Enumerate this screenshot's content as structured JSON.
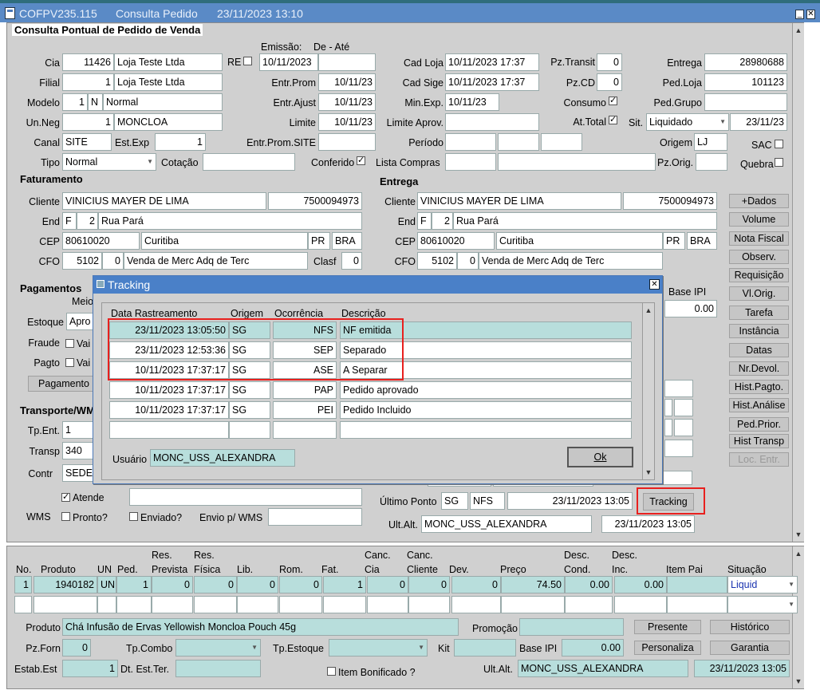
{
  "window": {
    "app_code": "COFPV235.115",
    "screen": "Consulta Pedido",
    "datetime": "23/11/2023 13:10",
    "min_label": "_",
    "close_label": "✕"
  },
  "form": {
    "title": "Consulta Pontual de Pedido de Venda",
    "emissao_label": "Emissão:",
    "de_ate_label": "De - Até",
    "cia_label": "Cia",
    "cia_code": "11426",
    "cia_name": "Loja Teste Ltda",
    "re_label": "RE",
    "emissao_de": "10/11/2023",
    "cad_loja_label": "Cad Loja",
    "cad_loja": "10/11/2023 17:37",
    "pz_transit_label": "Pz.Transit",
    "pz_transit": "0",
    "entrega_label": "Entrega",
    "entrega": "28980688",
    "filial_label": "Filial",
    "filial_code": "1",
    "filial_name": "Loja Teste Ltda",
    "entr_prom_label": "Entr.Prom",
    "entr_prom": "10/11/23",
    "cad_sige_label": "Cad Sige",
    "cad_sige": "10/11/2023 17:37",
    "pz_cd_label": "Pz.CD",
    "pz_cd": "0",
    "ped_loja_label": "Ped.Loja",
    "ped_loja": "101123",
    "modelo_label": "Modelo",
    "modelo_code": "1",
    "modelo_flag": "N",
    "modelo_name": "Normal",
    "entr_ajust_label": "Entr.Ajust",
    "entr_ajust": "10/11/23",
    "min_exp_label": "Min.Exp.",
    "min_exp": "10/11/23",
    "consumo_label": "Consumo",
    "ped_grupo_label": "Ped.Grupo",
    "un_neg_label": "Un.Neg",
    "un_neg_code": "1",
    "un_neg_name": "MONCLOA",
    "limite_label": "Limite",
    "limite": "10/11/23",
    "limite_aprov_label": "Limite Aprov.",
    "at_total_label": "At.Total",
    "sit_label": "Sit.",
    "sit_value": "Liquidado",
    "sit_date": "23/11/23",
    "canal_label": "Canal",
    "canal": "SITE",
    "est_exp_label": "Est.Exp",
    "est_exp": "1",
    "entr_prom_site_label": "Entr.Prom.SITE",
    "periodo_label": "Período",
    "origem_label": "Origem",
    "origem": "LJ",
    "sac_label": "SAC",
    "tipo_label": "Tipo",
    "tipo": "Normal",
    "cotacao_label": "Cotação",
    "conferido_label": "Conferido",
    "lista_compras_label": "Lista Compras",
    "pz_orig_label": "Pz.Orig.",
    "quebra_label": "Quebra",
    "faturamento_label": "Faturamento",
    "entrega_section_label": "Entrega",
    "cliente_label": "Cliente",
    "end_label": "End",
    "cep_label": "CEP",
    "cfo_label": "CFO",
    "clasf_label": "Clasf",
    "fat_cliente": "VINICIUS MAYER DE LIMA",
    "fat_cliente_code": "7500094973",
    "fat_end_type": "F",
    "fat_end_num": "2",
    "fat_end_street": "Rua Pará",
    "fat_cep": "80610020",
    "fat_city": "Curitiba",
    "fat_uf": "PR",
    "fat_country": "BRA",
    "fat_cfo": "5102",
    "fat_cfo_seq": "0",
    "fat_cfo_desc": "Venda de Merc Adq de Terc",
    "clasf": "0",
    "ent_cliente": "VINICIUS MAYER DE LIMA",
    "ent_cliente_code": "7500094973",
    "ent_end_type": "F",
    "ent_end_num": "2",
    "ent_end_street": "Rua Pará",
    "ent_cep": "80610020",
    "ent_city": "Curitiba",
    "ent_uf": "PR",
    "ent_country": "BRA",
    "ent_cfo": "5102",
    "ent_cfo_seq": "0",
    "ent_cfo_desc": "Venda de Merc Adq de Terc",
    "pagamentos_label": "Pagamentos",
    "meio_label": "Meio",
    "estoque_label": "Estoque",
    "estoque_value": "Apro",
    "fraude_label": "Fraude",
    "fraude_chk": "Vai",
    "pagto_label": "Pagto",
    "pagto_chk": "Vai",
    "pagamento_btn": "Pagamento",
    "base_ipi_label": "Base IPI",
    "base_ipi": "0.00",
    "transporte_label": "Transporte/WM",
    "tp_ent_label": "Tp.Ent.",
    "tp_ent": "1",
    "transp_label": "Transp",
    "transp": "340",
    "contr_label": "Contr",
    "contr": "SEDE",
    "atende_label": "Atende",
    "wms_label": "WMS",
    "pronto_label": "Pronto?",
    "enviado_label": "Enviado?",
    "envio_wms_label": "Envio p/ WMS",
    "ultimo_ponto_label": "Último Ponto",
    "ultimo_ponto_origem": "SG",
    "ultimo_ponto_code": "NFS",
    "ultimo_ponto_date": "23/11/2023 13:05",
    "tracking_btn": "Tracking",
    "ult_alt_label": "Ult.Alt.",
    "ult_alt_user": "MONC_USS_ALEXANDRA",
    "ult_alt_date": "23/11/2023 13:05"
  },
  "side_buttons": [
    "+Dados",
    "Volume",
    "Nota Fiscal",
    "Observ.",
    "Requisição",
    "Vl.Orig.",
    "Tarefa",
    "Instância",
    "Datas",
    "Nr.Devol.",
    "Hist.Pagto.",
    "Hist.Análise",
    "Ped.Prior.",
    "Hist Transp",
    "Loc. Entr."
  ],
  "tracking": {
    "title": "Tracking",
    "close_label": "✕",
    "headers": {
      "data": "Data Rastreamento",
      "origem": "Origem",
      "ocorrencia": "Ocorrência",
      "descricao": "Descrição"
    },
    "rows": [
      {
        "data": "23/11/2023 13:05:50",
        "origem": "SG",
        "ocorrencia": "NFS",
        "descricao": "NF emitida"
      },
      {
        "data": "23/11/2023 12:53:36",
        "origem": "SG",
        "ocorrencia": "SEP",
        "descricao": "Separado"
      },
      {
        "data": "10/11/2023 17:37:17",
        "origem": "SG",
        "ocorrencia": "ASE",
        "descricao": "A Separar"
      },
      {
        "data": "10/11/2023 17:37:17",
        "origem": "SG",
        "ocorrencia": "PAP",
        "descricao": "Pedido aprovado"
      },
      {
        "data": "10/11/2023 17:37:17",
        "origem": "SG",
        "ocorrencia": "PEI",
        "descricao": "Pedido Incluido"
      }
    ],
    "usuario_label": "Usuário",
    "usuario": "MONC_USS_ALEXANDRA",
    "ok_label": "Ok"
  },
  "items": {
    "headers": {
      "no": "No.",
      "produto": "Produto",
      "un": "UN",
      "ped": "Ped.",
      "res_prevista": "Res.\nPrevista",
      "res_fisica": "Res.\nFísica",
      "lib": "Lib.",
      "rom": "Rom.",
      "fat": "Fat.",
      "canc_cia": "Canc.\nCia",
      "canc_cliente": "Canc.\nCliente",
      "dev": "Dev.",
      "preco": "Preço",
      "desc_cond": "Desc.\nCond.",
      "desc_inc": "Desc.\nInc.",
      "item_pai": "Item Pai",
      "situacao": "Situação"
    },
    "row": {
      "no": "1",
      "produto": "1940182",
      "un": "UN",
      "ped": "1",
      "res_prevista": "0",
      "res_fisica": "0",
      "lib": "0",
      "rom": "0",
      "fat": "1",
      "canc_cia": "0",
      "canc_cliente": "0",
      "dev": "0",
      "preco": "74.50",
      "desc_cond": "0.00",
      "desc_inc": "0.00",
      "item_pai": "",
      "situacao": "Liquid"
    },
    "produto_label": "Produto",
    "produto_desc": "Chá Infusão de Ervas Yellowish Moncloa Pouch 45g",
    "promocao_label": "Promoção",
    "pz_forn_label": "Pz.Forn",
    "pz_forn": "0",
    "tp_combo_label": "Tp.Combo",
    "tp_estoque_label": "Tp.Estoque",
    "kit_label": "Kit",
    "base_ipi_label": "Base IPI",
    "base_ipi": "0.00",
    "estab_est_label": "Estab.Est",
    "estab_est": "1",
    "dt_est_ter_label": "Dt. Est.Ter.",
    "item_bonificado_label": "Item Bonificado ?",
    "ult_alt_label": "Ult.Alt.",
    "ult_alt_user": "MONC_USS_ALEXANDRA",
    "ult_alt_date": "23/11/2023 13:05",
    "presente_btn": "Presente",
    "historico_btn": "Histórico",
    "personaliza_btn": "Personaliza",
    "garantia_btn": "Garantia"
  },
  "colors": {
    "titlebar": "#5a8ac6",
    "form_bg": "#d0d0d0",
    "readonly_field": "#b8dedc",
    "highlight": "#e8201e"
  }
}
